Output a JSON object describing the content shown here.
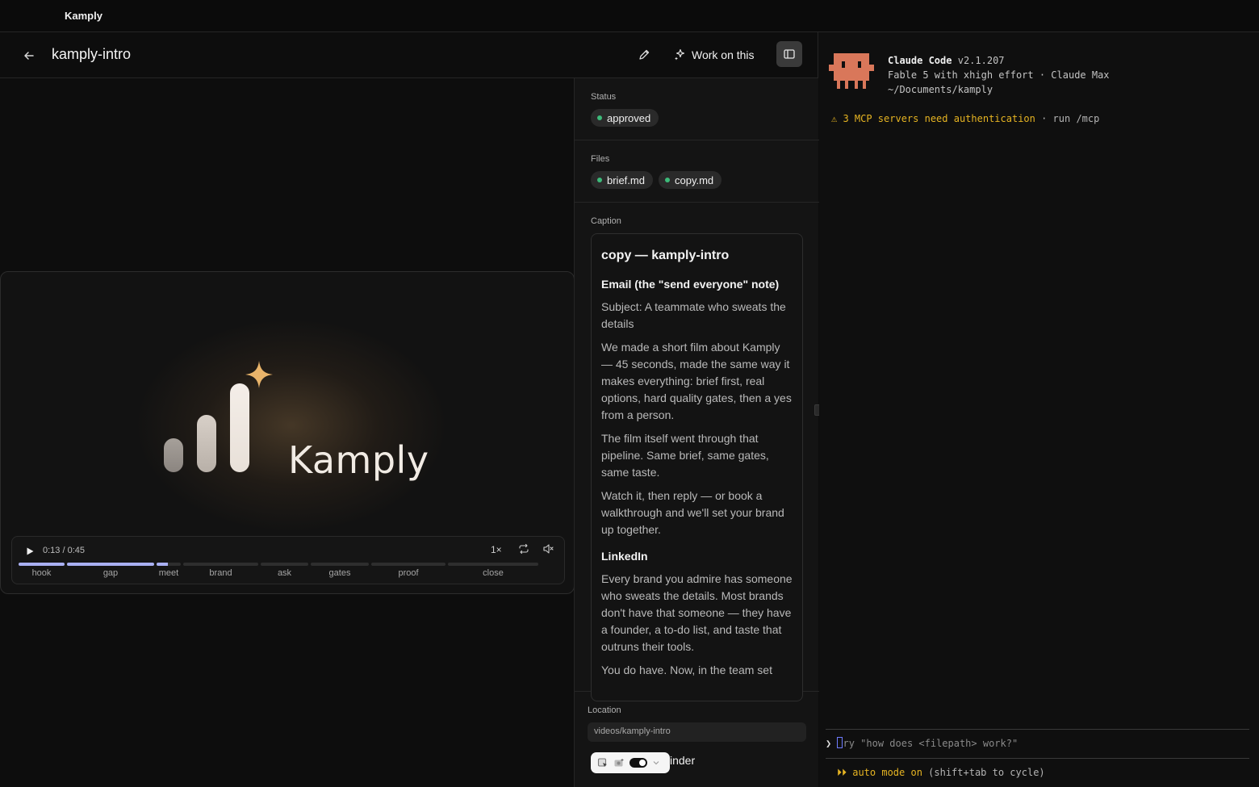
{
  "app": {
    "title": "Kamply"
  },
  "header": {
    "title": "kamply-intro",
    "work_label": "Work on this"
  },
  "player": {
    "logo_text": "Kamply",
    "time": "0:13 / 0:45",
    "speed": "1×",
    "progress_fraction": 0.29,
    "accent": "#a9b0f2",
    "segments": [
      {
        "label": "hook",
        "progress": 1.0
      },
      {
        "label": "gap",
        "progress": 1.0
      },
      {
        "label": "meet",
        "progress": 0.45
      },
      {
        "label": "brand",
        "progress": 0
      },
      {
        "label": "ask",
        "progress": 0
      },
      {
        "label": "gates",
        "progress": 0
      },
      {
        "label": "proof",
        "progress": 0
      },
      {
        "label": "close",
        "progress": 0
      }
    ]
  },
  "details": {
    "status_label": "Status",
    "status_value": "approved",
    "status_color": "#3dbb7a",
    "files_label": "Files",
    "files": [
      "brief.md",
      "copy.md"
    ],
    "caption_label": "Caption",
    "caption": {
      "title": "copy — kamply-intro",
      "email_heading": "Email (the \"send everyone\" note)",
      "email_paragraphs": [
        "Subject: A teammate who sweats the details",
        "We made a short film about Kamply — 45 seconds, made the same way it makes everything: brief first, real options, hard quality gates, then a yes from a person.",
        "The film itself went through that pipeline. Same brief, same gates, same taste.",
        "Watch it, then reply — or book a walkthrough and we'll set your brand up together."
      ],
      "linkedin_heading": "LinkedIn",
      "linkedin_paragraphs": [
        "Every brand you admire has someone who sweats the details. Most brands don't have that someone — they have a founder, a to-do list, and taste that outruns their tools.",
        "You do have. Now, in the team set"
      ]
    },
    "location_label": "Location",
    "location_value": "videos/kamply-intro",
    "finder_label": "inder"
  },
  "terminal": {
    "product": "Claude Code",
    "version": "v2.1.207",
    "model_line": "Fable 5 with xhigh effort · Claude Max",
    "path": "~/Documents/kamply",
    "warning_main": "⚠ 3 MCP servers need authentication",
    "warning_suffix": " · run /mcp",
    "prompt_glyph": "❯",
    "input_placeholder": "ry \"how does <filepath> work?\"",
    "automode_main": "⏵⏵ auto mode on",
    "automode_suffix": " (shift+tab to cycle)",
    "warning_color": "#e6b422",
    "mascot_color": "#d9775a"
  }
}
